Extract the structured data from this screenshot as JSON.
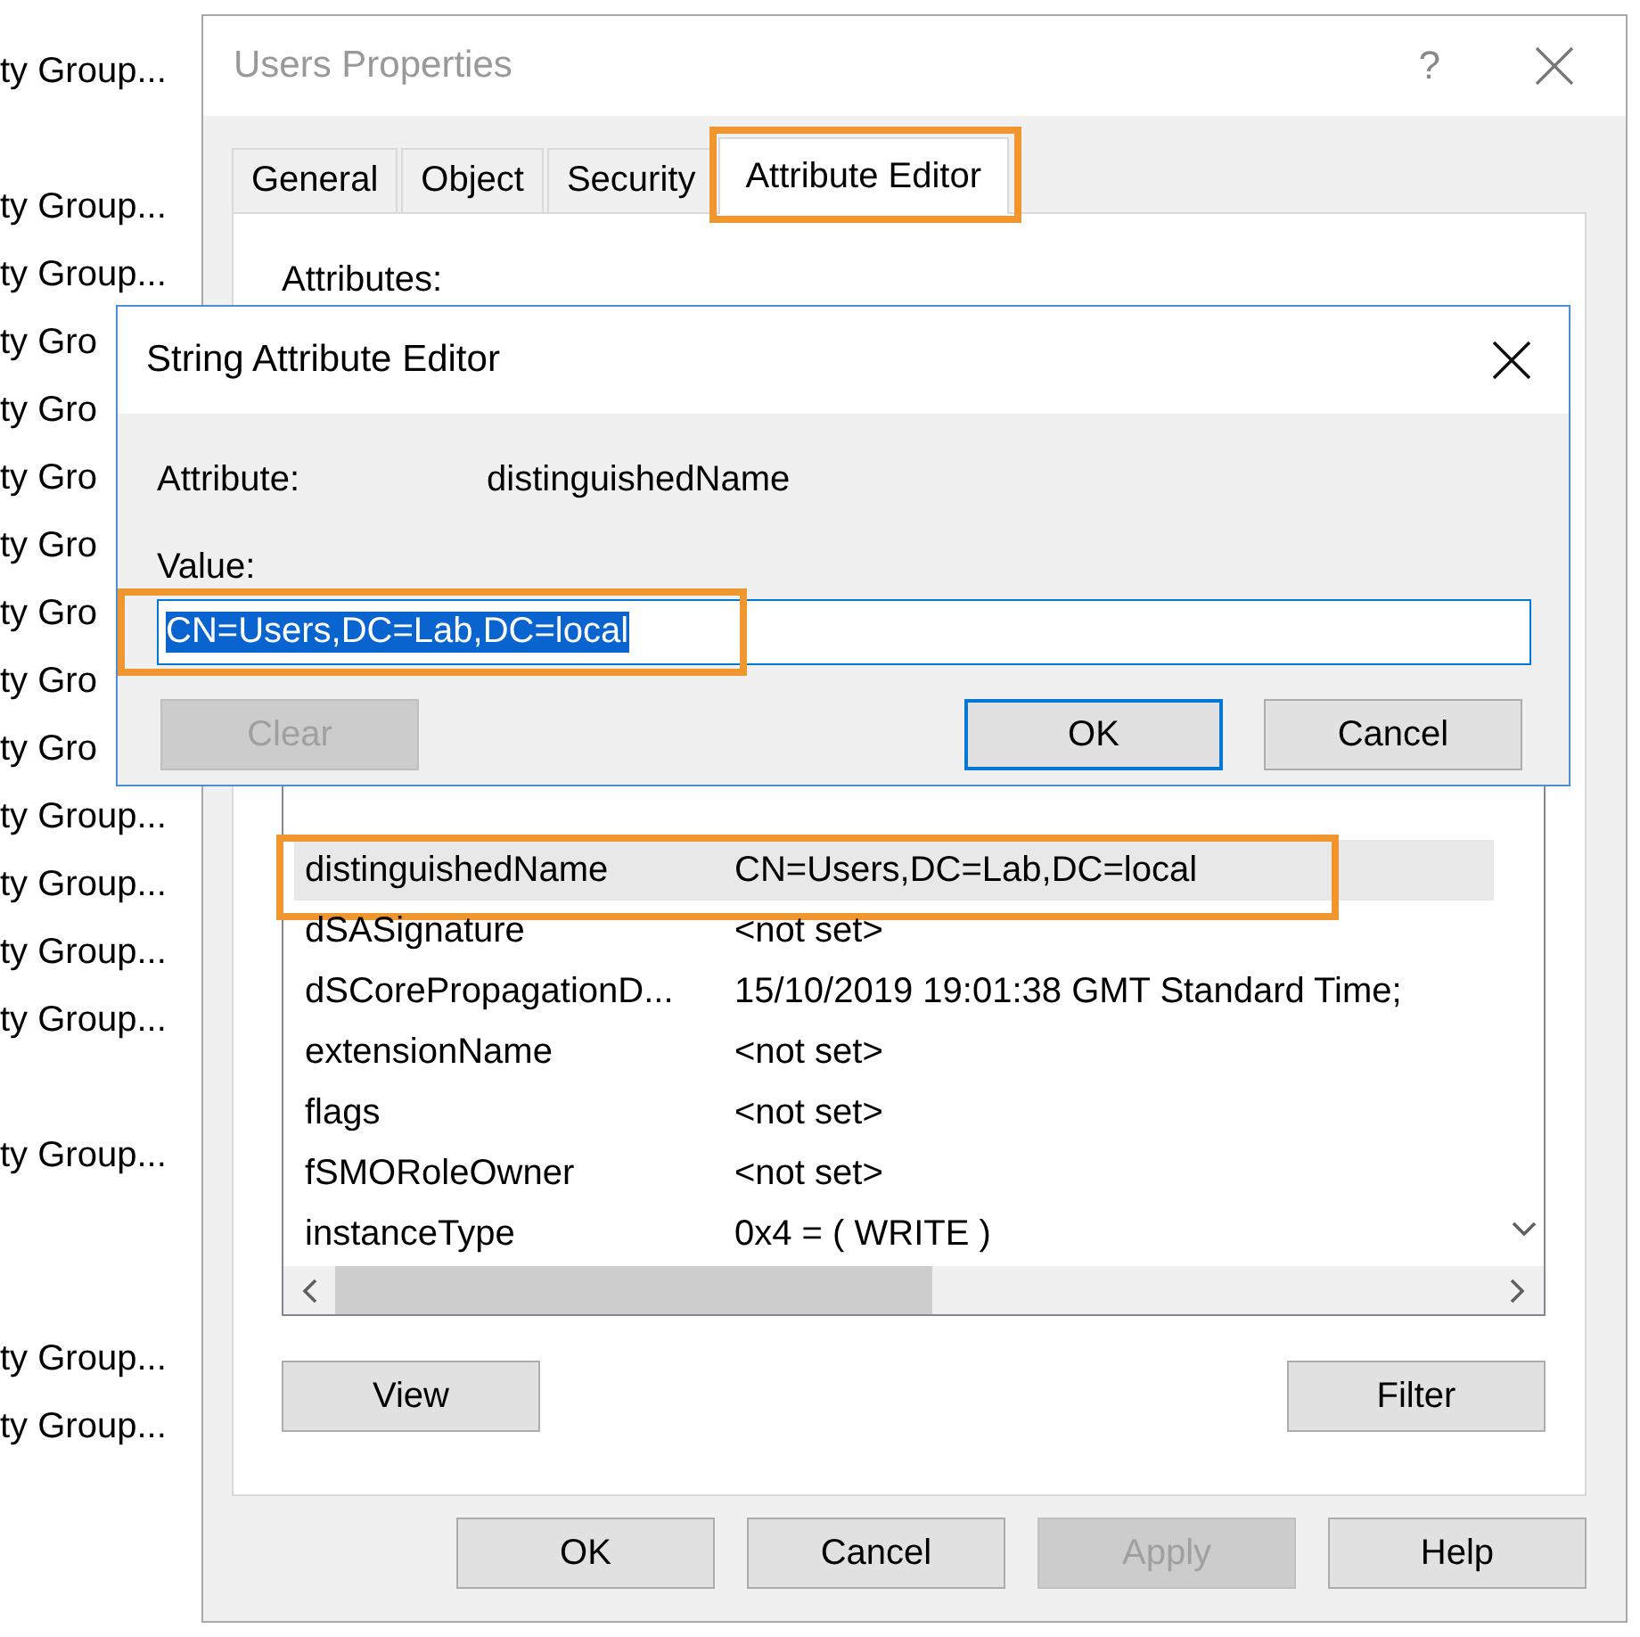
{
  "background_list": {
    "items": [
      {
        "text": "ty Group..."
      },
      {
        "text": "ty Group..."
      },
      {
        "text": "ty Group..."
      },
      {
        "text": "ty Gro"
      },
      {
        "text": "ty Gro"
      },
      {
        "text": "ty Gro"
      },
      {
        "text": "ty Gro"
      },
      {
        "text": "ty Gro"
      },
      {
        "text": "ty Gro"
      },
      {
        "text": "ty Gro"
      },
      {
        "text": "ty Group..."
      },
      {
        "text": "ty Group..."
      },
      {
        "text": "ty Group..."
      },
      {
        "text": "ty Group..."
      },
      {
        "text": "ty Group..."
      },
      {
        "text": "ty Group..."
      },
      {
        "text": "ty Group..."
      }
    ]
  },
  "properties_dialog": {
    "title": "Users Properties",
    "help": "?",
    "tabs": [
      {
        "label": "General",
        "selected": false,
        "highlighted": false
      },
      {
        "label": "Object",
        "selected": false,
        "highlighted": false
      },
      {
        "label": "Security",
        "selected": false,
        "highlighted": false
      },
      {
        "label": "Attribute Editor",
        "selected": true,
        "highlighted": true
      }
    ],
    "attributes_label": "Attributes:",
    "attributes": [
      {
        "name": "distinguishedName",
        "value": "CN=Users,DC=Lab,DC=local",
        "selected": true,
        "highlighted": true
      },
      {
        "name": "dSASignature",
        "value": "<not set>",
        "selected": false,
        "highlighted": false
      },
      {
        "name": "dSCorePropagationD...",
        "value": "15/10/2019 19:01:38 GMT Standard Time;",
        "selected": false,
        "highlighted": false
      },
      {
        "name": "extensionName",
        "value": "<not set>",
        "selected": false,
        "highlighted": false
      },
      {
        "name": "flags",
        "value": "<not set>",
        "selected": false,
        "highlighted": false
      },
      {
        "name": "fSMORoleOwner",
        "value": "<not set>",
        "selected": false,
        "highlighted": false
      },
      {
        "name": "instanceType",
        "value": "0x4 = ( WRITE )",
        "selected": false,
        "highlighted": false
      }
    ],
    "view_button": "View",
    "filter_button": "Filter",
    "buttons": [
      {
        "label": "OK",
        "disabled": false
      },
      {
        "label": "Cancel",
        "disabled": false
      },
      {
        "label": "Apply",
        "disabled": true
      },
      {
        "label": "Help",
        "disabled": false
      }
    ]
  },
  "string_editor": {
    "title": "String Attribute Editor",
    "attribute_label": "Attribute:",
    "attribute_value": "distinguishedName",
    "value_label": "Value:",
    "value_field": {
      "value": "CN=Users,DC=Lab,DC=local",
      "selected": true,
      "highlighted": true
    },
    "buttons": [
      {
        "label": "Clear",
        "disabled": true,
        "default": false
      },
      {
        "label": "OK",
        "disabled": false,
        "default": true
      },
      {
        "label": "Cancel",
        "disabled": false,
        "default": false
      }
    ]
  }
}
